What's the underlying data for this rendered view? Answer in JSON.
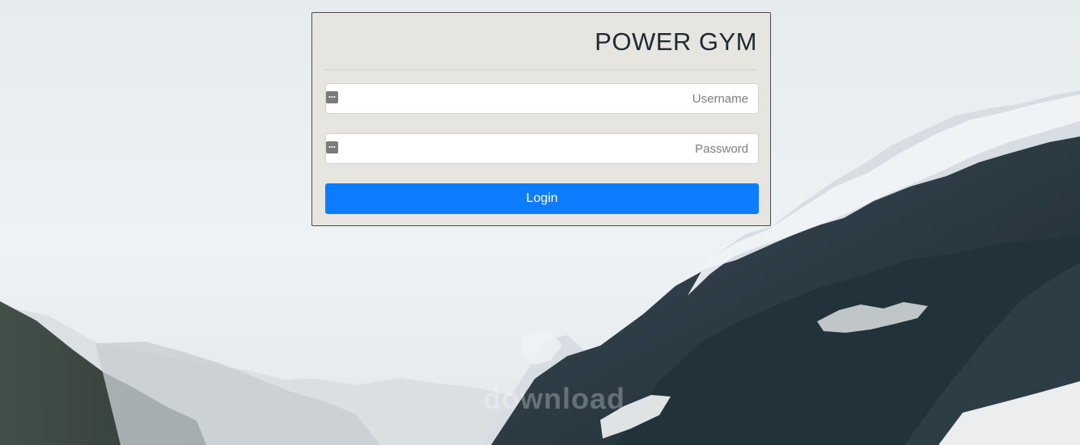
{
  "brand": {
    "title": "POWER GYM"
  },
  "form": {
    "username_placeholder": "Username",
    "username_value": "",
    "password_placeholder": "Password",
    "password_value": "",
    "login_label": "Login"
  },
  "colors": {
    "card_background": "#e7e5e0",
    "primary_button": "#0d7cff",
    "title_text": "#1f2a33"
  },
  "icons": {
    "username_icon": "password-manager-key-icon",
    "password_icon": "password-manager-key-icon"
  }
}
